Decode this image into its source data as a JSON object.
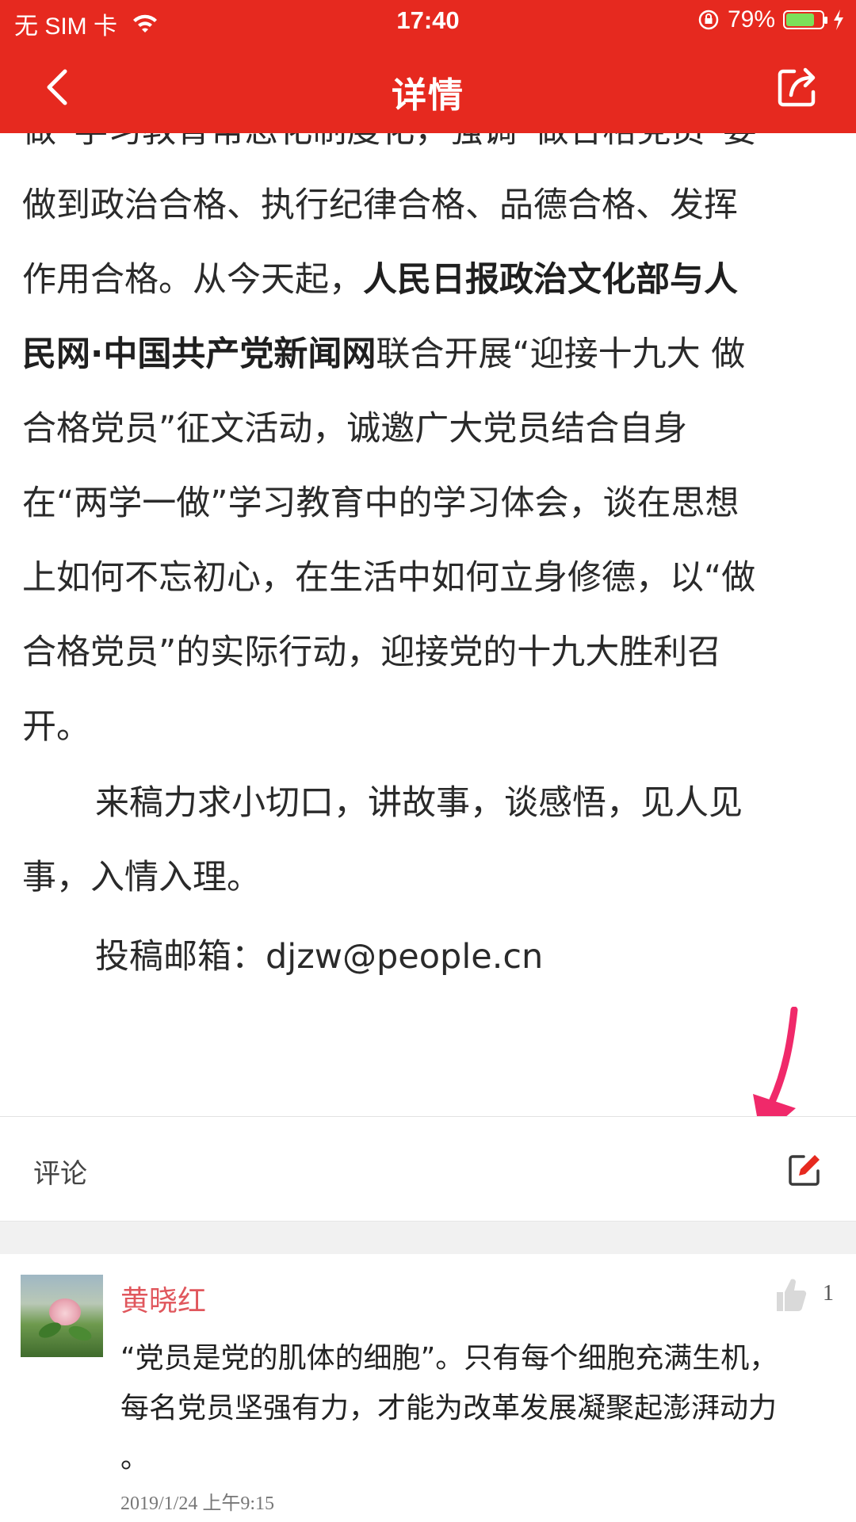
{
  "status_bar": {
    "carrier": "无 SIM 卡",
    "time": "17:40",
    "battery": "79%",
    "battery_level": 0.79
  },
  "nav": {
    "title": "详情",
    "back_icon": "chevron-left-icon",
    "share_icon": "share-icon"
  },
  "article": {
    "cut_line": "做“学习教育常态化制度化，强调“做合格党员”要",
    "paragraph1_lines": [
      "做到政治合格、执行纪律合格、品德合格、发挥",
      [
        "作用合格。从今天起，",
        "人民日报政治文化部与人"
      ],
      [
        "民网·中国共产党新闻网",
        "联合开展“迎接十九大 做"
      ],
      "合格党员”征文活动，诚邀广大党员结合自身",
      "在“两学一做”学习教育中的学习体会，谈在思想",
      "上如何不忘初心，在生活中如何立身修德，以“做",
      "合格党员”的实际行动，迎接党的十九大胜利召",
      "开。"
    ],
    "paragraph2_lines": [
      "来稿力求小切口，讲故事，谈感悟，见人见",
      "事，入情入理。"
    ],
    "email_line": "投稿邮箱：djzw@people.cn"
  },
  "comments_section": {
    "label": "评论",
    "edit_icon": "edit-icon"
  },
  "comments": [
    {
      "author": "黄晓红",
      "likes": "1",
      "text_lines": [
        "“党员是党的肌体的细胞”。只有每个细胞充满生机，",
        "每名党员坚强有力，才能为改革发展凝聚起澎湃动力",
        "。"
      ],
      "time": "2019/1/24 上午9:15"
    }
  ],
  "colors": {
    "header_red": "#e6291f",
    "author_name": "#e0575d",
    "annotation_arrow": "#f0296a"
  }
}
